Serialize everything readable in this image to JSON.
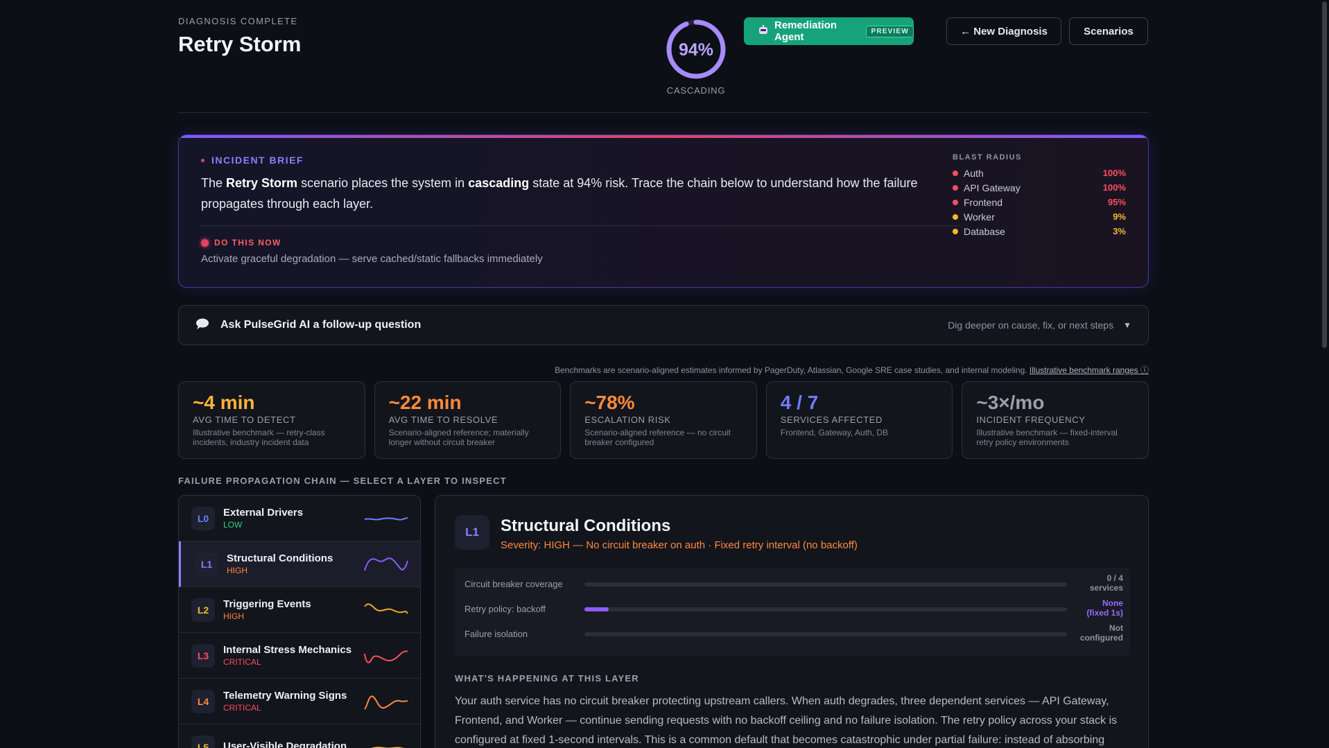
{
  "header": {
    "eyebrow": "DIAGNOSIS COMPLETE",
    "title": "Retry Storm",
    "risk_value": "94%",
    "risk_fraction": 0.94,
    "state_label": "CASCADING",
    "agent_button": "Remediation Agent",
    "agent_badge": "PREVIEW",
    "new_diagnosis": "← New Diagnosis",
    "scenarios": "Scenarios"
  },
  "brief": {
    "tag": "INCIDENT BRIEF",
    "text_pre": "The ",
    "text_scenario": "Retry Storm",
    "text_mid": " scenario places the system in ",
    "text_state": "cascading",
    "text_post": " state at 94% risk. Trace the chain below to understand how the failure propagates through each layer.",
    "do_now_label": "DO THIS NOW",
    "do_now_text": "Activate graceful degradation — serve cached/static fallbacks immediately",
    "blast_title": "BLAST RADIUS",
    "blast": [
      {
        "name": "Auth",
        "value": "100%",
        "color": "#ff4d5e"
      },
      {
        "name": "API Gateway",
        "value": "100%",
        "color": "#ff4d5e"
      },
      {
        "name": "Frontend",
        "value": "95%",
        "color": "#ff4d5e"
      },
      {
        "name": "Worker",
        "value": "9%",
        "color": "#f5b82e"
      },
      {
        "name": "Database",
        "value": "3%",
        "color": "#f5b82e"
      }
    ]
  },
  "ask": {
    "label": "Ask PulseGrid AI a follow-up question",
    "hint": "Dig deeper on cause, fix, or next steps"
  },
  "bench_note": {
    "text": "Benchmarks are scenario-aligned estimates informed by PagerDuty, Atlassian, Google SRE case studies, and internal modeling. ",
    "link": "Illustrative benchmark ranges ⓘ"
  },
  "stats": [
    {
      "value": "~4 min",
      "label": "AVG TIME TO DETECT",
      "desc": "Illustrative benchmark — retry-class incidents, industry incident data",
      "color": "#ffb23a"
    },
    {
      "value": "~22 min",
      "label": "AVG TIME TO RESOLVE",
      "desc": "Scenario-aligned reference; materially longer without circuit breaker",
      "color": "#ff8a3a"
    },
    {
      "value": "~78%",
      "label": "ESCALATION RISK",
      "desc": "Scenario-aligned reference — no circuit breaker configured",
      "color": "#ff8a3a"
    },
    {
      "value": "4 / 7",
      "label": "SERVICES AFFECTED",
      "desc": "Frontend, Gateway, Auth, DB",
      "color": "#6f7dff"
    },
    {
      "value": "~3×/mo",
      "label": "INCIDENT FREQUENCY",
      "desc": "Illustrative benchmark — fixed-interval retry policy environments",
      "color": "#9aa0ab"
    }
  ],
  "chain_title": "FAILURE PROPAGATION CHAIN — SELECT A LAYER TO INSPECT",
  "layers": [
    {
      "id": "L0",
      "name": "External Drivers",
      "severity": "LOW",
      "sev_color": "#2fd08a",
      "badge_color": "#6f7dff",
      "spark_color": "#6f7dff"
    },
    {
      "id": "L1",
      "name": "Structural Conditions",
      "severity": "HIGH",
      "sev_color": "#ff8a3a",
      "badge_color": "#8f7cff",
      "spark_color": "#8f5cff"
    },
    {
      "id": "L2",
      "name": "Triggering Events",
      "severity": "HIGH",
      "sev_color": "#ff8a3a",
      "badge_color": "#f5b82e",
      "spark_color": "#f5a52e"
    },
    {
      "id": "L3",
      "name": "Internal Stress Mechanics",
      "severity": "CRITICAL",
      "sev_color": "#ff4d5e",
      "badge_color": "#ff4d5e",
      "spark_color": "#ff4d5e"
    },
    {
      "id": "L4",
      "name": "Telemetry Warning Signs",
      "severity": "CRITICAL",
      "sev_color": "#ff4d5e",
      "badge_color": "#ff8a3a",
      "spark_color": "#ff8a3a"
    },
    {
      "id": "L5",
      "name": "User-Visible Degradation",
      "severity": "",
      "sev_color": "#ff4d5e",
      "badge_color": "#f5b82e",
      "spark_color": "#f5b82e"
    }
  ],
  "detail": {
    "badge": "L1",
    "title": "Structural Conditions",
    "severity": "Severity: HIGH — No circuit breaker on auth · Fixed retry interval (no backoff)",
    "metrics": [
      {
        "name": "Circuit breaker coverage",
        "value_line1": "0 / 4",
        "value_line2": "services",
        "fill": 0.0,
        "value_color": "#8f94a0"
      },
      {
        "name": "Retry policy: backoff",
        "value_line1": "None",
        "value_line2": "(fixed 1s)",
        "fill": 0.05,
        "value_color": "#9a6bff"
      },
      {
        "name": "Failure isolation",
        "value_line1": "Not",
        "value_line2": "configured",
        "fill": 0.0,
        "value_color": "#8f94a0"
      }
    ],
    "whats_title": "WHAT'S HAPPENING AT THIS LAYER",
    "whats_body": "Your auth service has no circuit breaker protecting upstream callers. When auth degrades, three dependent services — API Gateway, Frontend, and Worker — continue sending requests with no backoff ceiling and no failure isolation. The retry policy across your stack is configured at fixed 1-second intervals. This is a common default that becomes catastrophic under partial failure: instead of absorbing"
  }
}
